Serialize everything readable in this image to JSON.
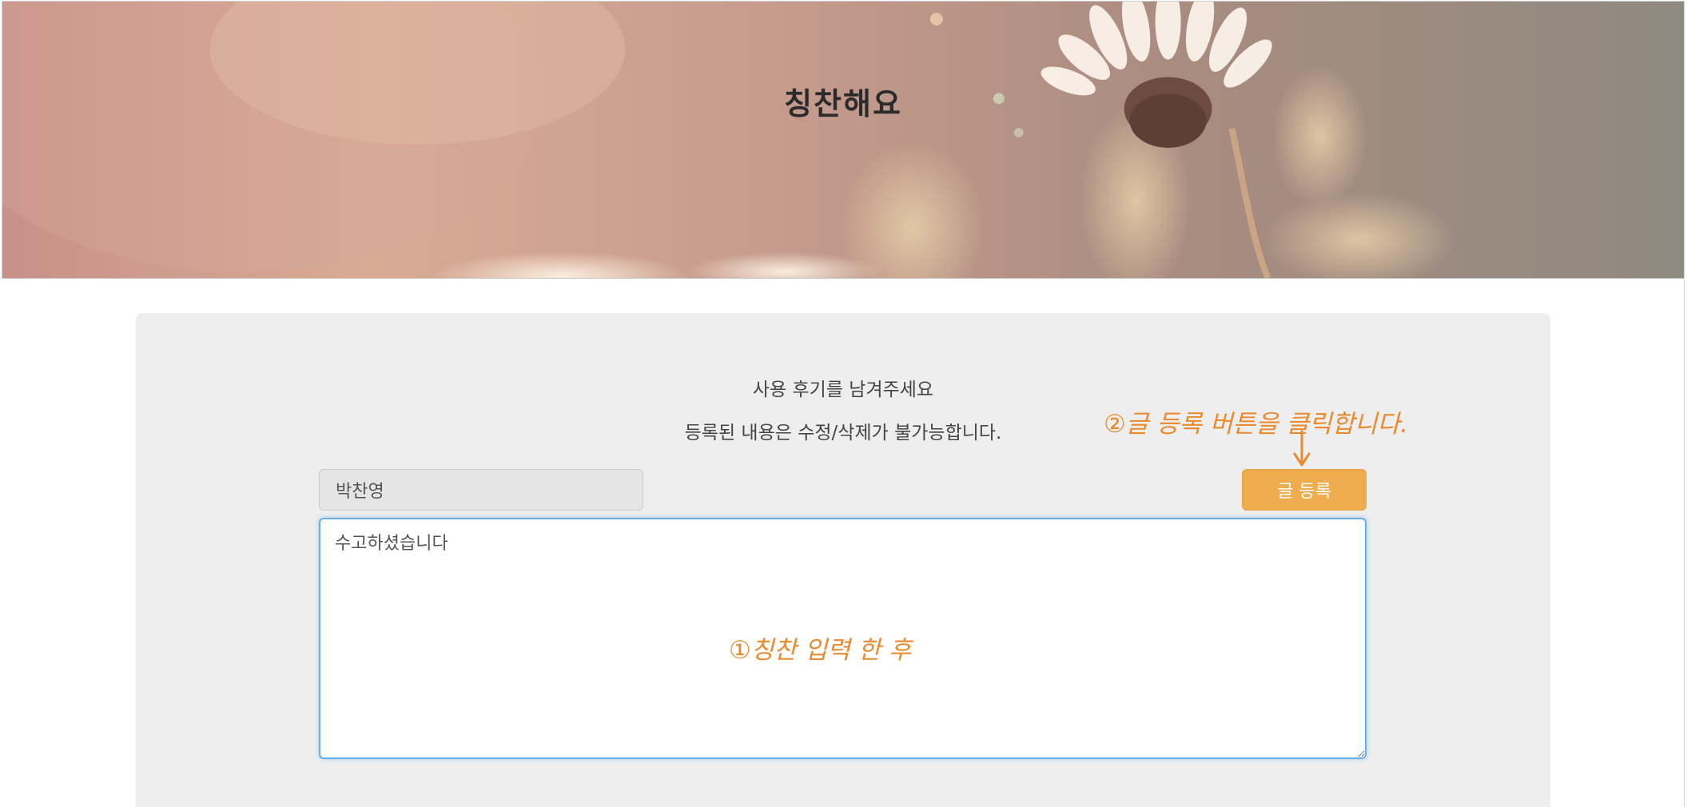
{
  "header": {
    "title": "칭찬해요"
  },
  "form": {
    "notice_line_1": "사용 후기를 남겨주세요",
    "notice_line_2": "등록된 내용은 수정/삭제가 불가능합니다.",
    "name_value": "박찬영",
    "submit_label": "글 등록",
    "message_value": "수고하셨습니다"
  },
  "annotations": {
    "step_2": "②글 등록 버튼을 클릭합니다.",
    "step_1": "①칭찬 입력 한 후"
  },
  "colors": {
    "submit_button": "#f0ad4e",
    "annotation": "#ea8a2c",
    "panel_background": "#eeeeee",
    "focus_border": "#66afe9"
  },
  "icons": {
    "annotation_arrow": "down-arrow-icon"
  }
}
